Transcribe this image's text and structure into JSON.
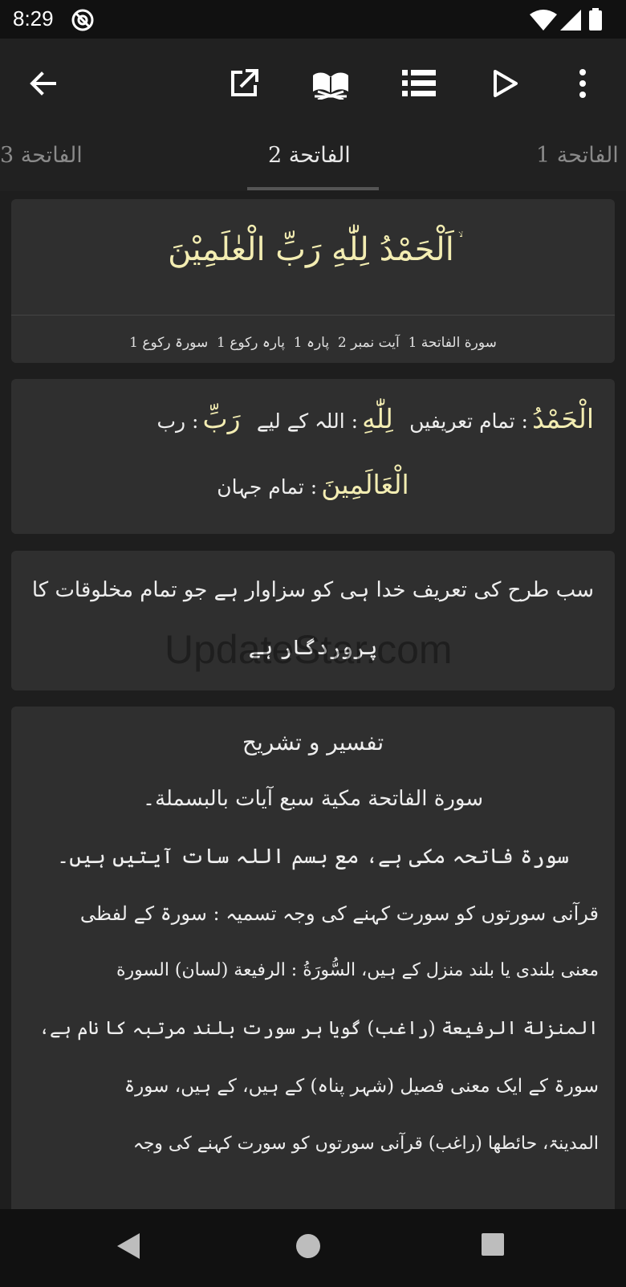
{
  "status_bar": {
    "time": "8:29"
  },
  "tabs": [
    {
      "label": "الفاتحة 3"
    },
    {
      "label": "الفاتحة 2"
    },
    {
      "label": "الفاتحة 1"
    }
  ],
  "ayah": {
    "arabic": "اَلْحَمْدُ لِلّٰهِ رَبِّ الْعٰلَمِيْنَ",
    "stop_mark": "ۙ",
    "meta": "سورة الفاتحة 1  آیت نمبر 2  پارہ 1  پارہ رکوع 1  سورۃ رکوع 1"
  },
  "word_by_word": {
    "w1_ar": "الْحَمْدُ",
    "w1_ur": ": تمام تعریفیں",
    "w2_ar": "لِلّٰهِ",
    "w2_ur": ": اللہ کے لیے",
    "w3_ar": "رَبِّ",
    "w3_ur": ": رب",
    "w4_ar": "الْعَالَمِينَ",
    "w4_ur": ": تمام جہان"
  },
  "translation": {
    "line1": "سب طرح کی تعریف خدا ہی کو سزاوار ہے جو تمام مخلوقات کا",
    "line2": "پروردگار ہے"
  },
  "tafseer": {
    "heading": "تفسیر و تشریح",
    "lines": [
      "سورة الفاتحة مكية سبع آيات بالبسملة۔",
      "سورۃ فاتحہ مکی ہے، مع بسم اللہ سات آیتیں ہیں۔",
      "قرآنی سورتوں کو سورت کہنے کی وجہ تسمیہ : سورۃ کے لفظی",
      "معنی بلندی یا بلند منزل کے ہیں، السُّورَةُ : الرفيعة (لسان) السورة",
      "المنزلة الرفيعة (راغب) گویا ہر سورت بلند مرتبہ کا نام ہے،",
      "سورۃ کے ایک معنی فصیل (شہر پناہ) کے ہیں، کے ہیں، سورۃ",
      "المدینۃ، حائطھا (راغب) قرآنی سورتوں کو سورت کہنے کی وجہ"
    ]
  },
  "watermark": "UpdateStar.com",
  "colors": {
    "arabic_text": "#f3edb2",
    "card_bg": "#2f2f2f",
    "app_bg": "#1e1e1e"
  }
}
